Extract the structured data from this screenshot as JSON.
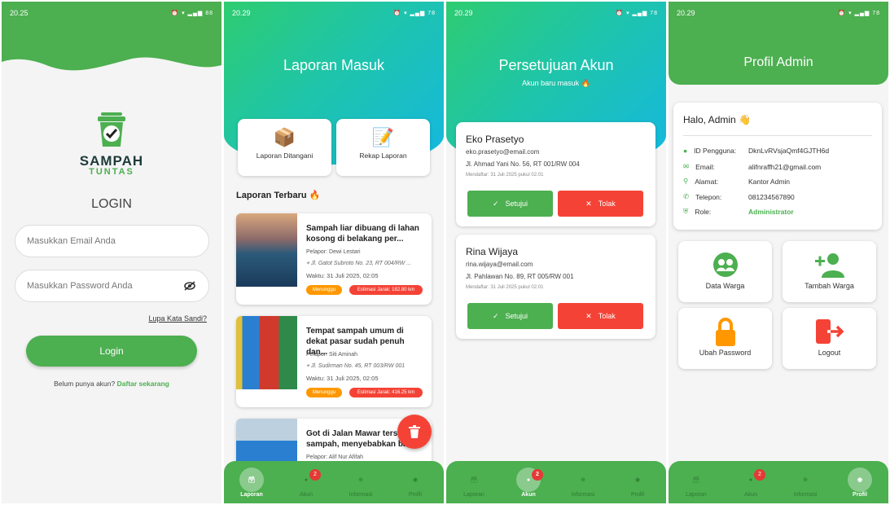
{
  "phone1": {
    "time": "20.25",
    "app_name": "SAMPAH",
    "app_sub": "TUNTAS",
    "login_title": "LOGIN",
    "email_placeholder": "Masukkan Email Anda",
    "password_placeholder": "Masukkan Password Anda",
    "forgot": "Lupa Kata Sandi?",
    "login_button": "Login",
    "no_account": "Belum punya akun?",
    "register": "Daftar sekarang"
  },
  "phone2": {
    "time": "20.29",
    "title": "Laporan Masuk",
    "menu": [
      "Laporan Ditangani",
      "Rekap Laporan"
    ],
    "section": "Laporan Terbaru 🔥",
    "reports": [
      {
        "title": "Sampah liar dibuang di lahan kosong di belakang per...",
        "reporter": "Pelapor: Dewi Lestari",
        "address": "Jl. Gatot Subroto No. 23, RT 004/RW ...",
        "time": "Waktu: 31 Juli 2025, 02:05",
        "status": "Menunggu",
        "distance": "Estimasi Jarak: 182.80 km"
      },
      {
        "title": "Tempat sampah umum di dekat pasar sudah penuh dan...",
        "reporter": "Pelapor: Siti Aminah",
        "address": "Jl. Sudirman No. 45, RT 003/RW 001",
        "time": "Waktu: 31 Juli 2025, 02:05",
        "status": "Menunggu",
        "distance": "Estimasi Jarak: 416.25 km"
      },
      {
        "title": "Got di Jalan Mawar tersu... sampah, menyebabkan ba...",
        "reporter": "Pelapor: Alif Nur Afifah"
      }
    ]
  },
  "phone3": {
    "time": "20.29",
    "title": "Persetujuan Akun",
    "subtitle": "Akun baru masuk 🔥",
    "accounts": [
      {
        "name": "Eko Prasetyo",
        "email": "eko.prasetyo@email.com",
        "address": "Jl. Ahmad Yani No. 56, RT 001/RW 004",
        "date": "Mendaftar: 31 Juli 2025 pukul 02.01"
      },
      {
        "name": "Rina Wijaya",
        "email": "rina.wijaya@email.com",
        "address": "Jl. Pahlawan No. 89, RT 005/RW 001",
        "date": "Mendaftar: 31 Juli 2025 pukul 02.01"
      }
    ],
    "approve": "Setujui",
    "reject": "Tolak"
  },
  "phone4": {
    "time": "20.29",
    "title": "Profil Admin",
    "greeting": "Halo, Admin 👋",
    "fields": [
      {
        "label": "ID Pengguna:",
        "value": "DknLvRVsjaQmf4GJTH6d"
      },
      {
        "label": "Email:",
        "value": "alifnraffh21@gmail.com"
      },
      {
        "label": "Alamat:",
        "value": "Kantor Admin"
      },
      {
        "label": "Telepon:",
        "value": "081234567890"
      },
      {
        "label": "Role:",
        "value": "Administrator"
      }
    ],
    "tiles": [
      "Data Warga",
      "Tambah Warga",
      "Ubah Password",
      "Logout"
    ]
  },
  "nav": {
    "items": [
      "Laporan",
      "Akun",
      "Informasi",
      "Profil"
    ],
    "badge": "2"
  },
  "colors": {
    "primary": "#4caf50",
    "danger": "#f44336",
    "warning": "#ff9800"
  }
}
